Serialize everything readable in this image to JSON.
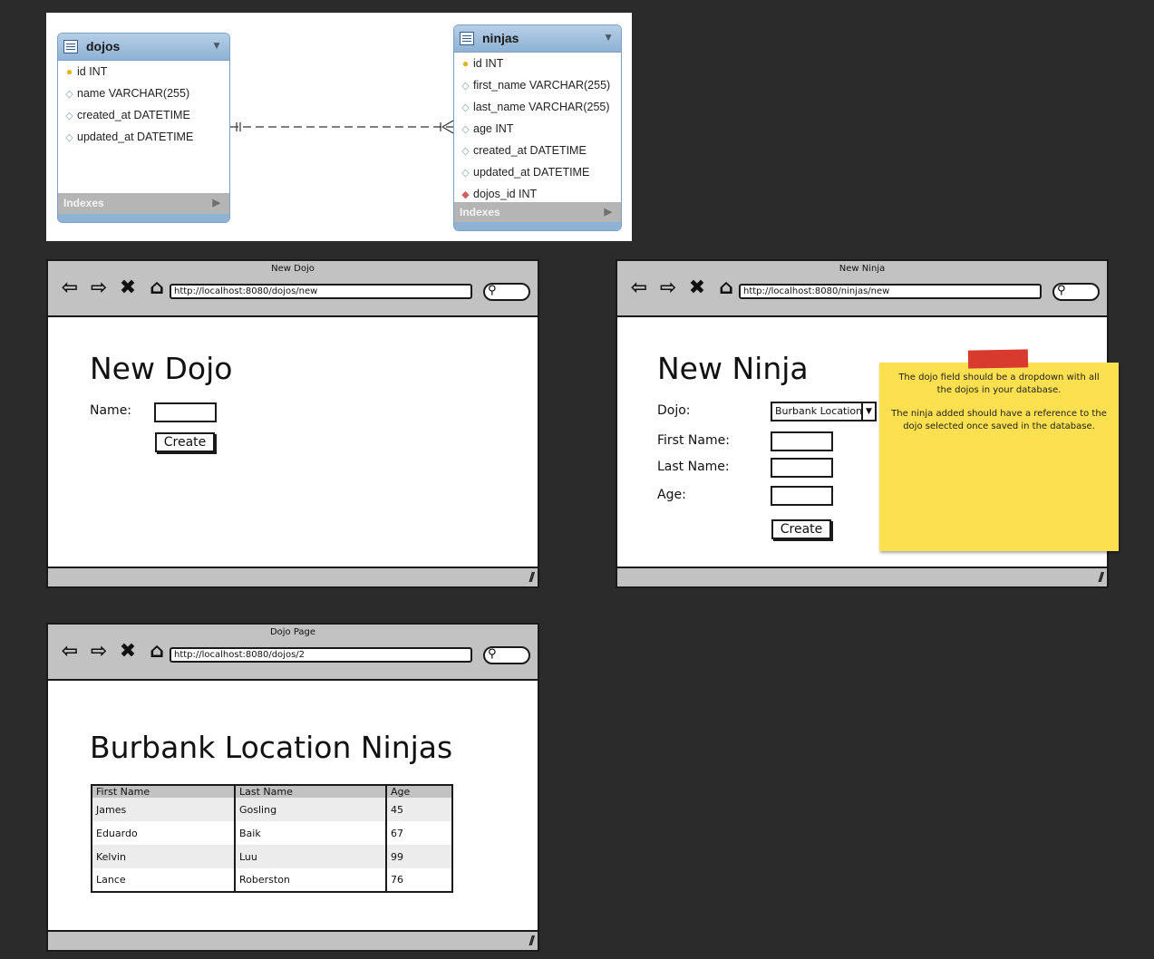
{
  "erd": {
    "tables": [
      {
        "name": "dojos",
        "columns": [
          {
            "text": "id INT",
            "icon": "primary-key-icon"
          },
          {
            "text": "name VARCHAR(255)",
            "icon": "column-icon"
          },
          {
            "text": "created_at DATETIME",
            "icon": "column-icon"
          },
          {
            "text": "updated_at DATETIME",
            "icon": "column-icon"
          }
        ],
        "indexes_label": "Indexes"
      },
      {
        "name": "ninjas",
        "columns": [
          {
            "text": "id INT",
            "icon": "primary-key-icon"
          },
          {
            "text": "first_name VARCHAR(255)",
            "icon": "column-icon"
          },
          {
            "text": "last_name VARCHAR(255)",
            "icon": "column-icon"
          },
          {
            "text": "age INT",
            "icon": "column-icon"
          },
          {
            "text": "created_at DATETIME",
            "icon": "column-icon"
          },
          {
            "text": "updated_at DATETIME",
            "icon": "column-icon"
          },
          {
            "text": "dojos_id INT",
            "icon": "foreign-key-icon"
          }
        ],
        "indexes_label": "Indexes"
      }
    ],
    "relationship": "one-to-many"
  },
  "new_dojo": {
    "window_title": "New Dojo",
    "url": "http://localhost:8080/dojos/new",
    "heading": "New Dojo",
    "name_label": "Name:",
    "create_label": "Create"
  },
  "new_ninja": {
    "window_title": "New Ninja",
    "url": "http://localhost:8080/ninjas/new",
    "heading": "New Ninja",
    "dojo_label": "Dojo:",
    "dojo_selected": "Burbank Location",
    "first_name_label": "First Name:",
    "last_name_label": "Last Name:",
    "age_label": "Age:",
    "create_label": "Create",
    "note_line1": "The dojo field should be a dropdown with all the dojos in your database.",
    "note_line2": "The ninja added should have a reference to the dojo selected once saved in the database."
  },
  "dojo_page": {
    "window_title": "Dojo Page",
    "url": "http://localhost:8080/dojos/2",
    "heading": "Burbank Location Ninjas",
    "columns": [
      "First Name",
      "Last Name",
      "Age"
    ],
    "rows": [
      [
        "James",
        "Gosling",
        "45"
      ],
      [
        "Eduardo",
        "Baik",
        "67"
      ],
      [
        "Kelvin",
        "Luu",
        "99"
      ],
      [
        "Lance",
        "Roberston",
        "76"
      ]
    ]
  },
  "colors": {
    "background": "#2b2b2b",
    "er_header": "#8eb2d4",
    "wireframe_chrome": "#c2c2c2",
    "sticky_note": "#fce04f",
    "sticky_tape": "#d83b2d"
  }
}
